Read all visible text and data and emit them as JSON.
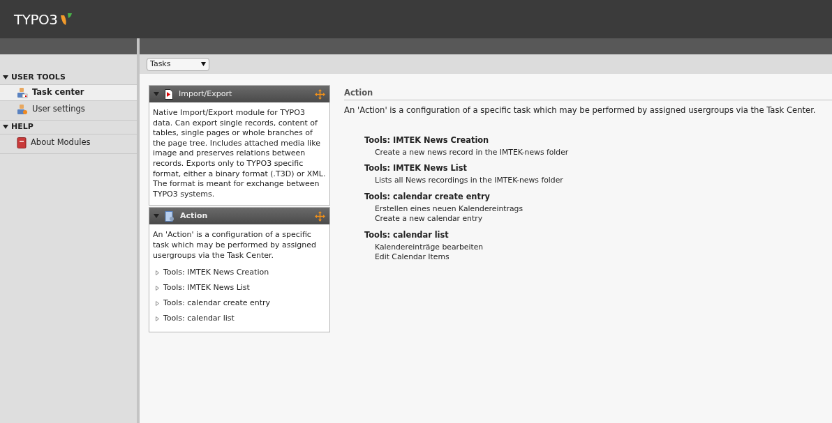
{
  "logo": {
    "text": "TYPO3"
  },
  "sidebar": {
    "groups": [
      {
        "label": "USER TOOLS",
        "expanded": true,
        "items": [
          {
            "label": "Task center",
            "kind": "task",
            "selected": true
          },
          {
            "label": "User settings",
            "kind": "user",
            "selected": false
          }
        ]
      },
      {
        "label": "HELP",
        "expanded": true,
        "items": [
          {
            "label": "About Modules",
            "kind": "book",
            "selected": false
          }
        ]
      }
    ]
  },
  "toolbar": {
    "select": {
      "value": "Tasks"
    }
  },
  "widgets": [
    {
      "title": "Import/Export",
      "kind": "export",
      "expanded": true,
      "text": "Native Import/Export module for TYPO3 data. Can export single records, content of tables, single pages or whole branches of the page tree. Includes attached media like image and preserves relations between records. Exports only to TYPO3 specific format, either a binary format (.T3D) or XML. The format is meant for exchange between TYPO3 systems."
    },
    {
      "title": "Action",
      "kind": "action",
      "expanded": true,
      "text": "An 'Action' is a configuration of a specific task which may be performed by assigned usergroups via the Task Center.",
      "links": [
        "Tools: IMTEK News Creation",
        "Tools: IMTEK News List",
        "Tools: calendar create entry",
        "Tools: calendar list"
      ]
    }
  ],
  "main": {
    "heading": "Action",
    "intro": "An 'Action' is a configuration of a specific task which may be performed by assigned usergroups via the Task Center.",
    "actions": [
      {
        "title": "Tools: IMTEK News Creation",
        "lines": [
          "Create a new news record in the IMTEK-news folder"
        ]
      },
      {
        "title": "Tools: IMTEK News List",
        "lines": [
          "Lists all News recordings in the IMTEK-news folder"
        ]
      },
      {
        "title": "Tools: calendar create entry",
        "lines": [
          "Erstellen eines neuen Kalendereintrags",
          "Create a new calendar entry"
        ]
      },
      {
        "title": "Tools: calendar list",
        "lines": [
          "Kalendereinträge bearbeiten",
          "Edit Calendar Items"
        ]
      }
    ]
  }
}
